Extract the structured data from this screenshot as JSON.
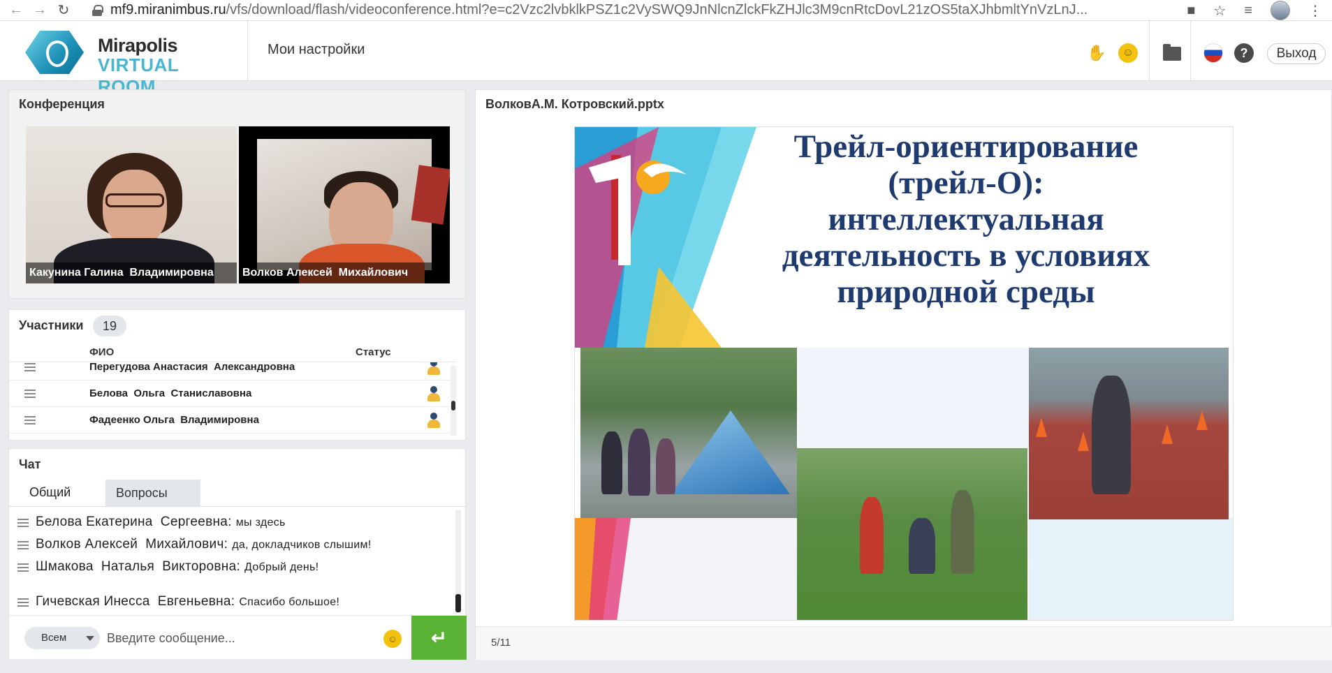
{
  "browser": {
    "url_host": "mf9.miranimbus.ru",
    "url_path": "/vfs/download/flash/videoconference.html?e=c2Vzc2lvbklkPSZ1c2VySWQ9JnNlcnZlckFkZHJlc3M9cnRtcDovL21zOS5taXJhbmltYnVzLnJ..."
  },
  "header": {
    "logo_line1": "Mirapolis",
    "logo_line2": "VIRTUAL ROOM",
    "settings_label": "Мои настройки",
    "logout_label": "Выход",
    "help_label": "?"
  },
  "conference": {
    "title": "Конференция",
    "videos": [
      {
        "name": "Какунина Галина  Владимировна"
      },
      {
        "name": "Волков Алексей  Михайлович"
      }
    ]
  },
  "participants": {
    "title": "Участники",
    "count": "19",
    "col_name": "ФИО",
    "col_status": "Статус",
    "rows": [
      {
        "name": "Перегудова Анастасия  Александровна"
      },
      {
        "name": "Белова  Ольга  Станиславовна"
      },
      {
        "name": "Фадеенко Ольга  Владимировна"
      }
    ]
  },
  "chat": {
    "title": "Чат",
    "tab_general": "Общий",
    "tab_questions": "Вопросы",
    "messages": [
      {
        "author": "Белова Екатерина  Сергеевна:",
        "text": "мы здесь"
      },
      {
        "author": "Волков Алексей  Михайлович:",
        "text": "да, докладчиков слышим!"
      },
      {
        "author": "Шмакова  Наталья  Викторовна:",
        "text": "Добрый день!"
      },
      {
        "author": "Гичевская Инесса  Евгеньевна:",
        "text": "Спасибо большое!"
      }
    ],
    "recipient": "Всем",
    "input_placeholder": "Введите сообщение...",
    "send_symbol": "↵"
  },
  "presentation": {
    "title": "ВолковА.М. Котровский.pptx",
    "slide_title_lines": [
      "Трейл-ориентирование",
      "(трейл-О):",
      "интеллектуальная",
      "деятельность в условиях",
      "природной среды"
    ],
    "slide_counter": "5/11"
  },
  "colors": {
    "accent_green": "#5bb336",
    "slide_title": "#1f3a6e",
    "logo_blue": "#47b6d0"
  }
}
